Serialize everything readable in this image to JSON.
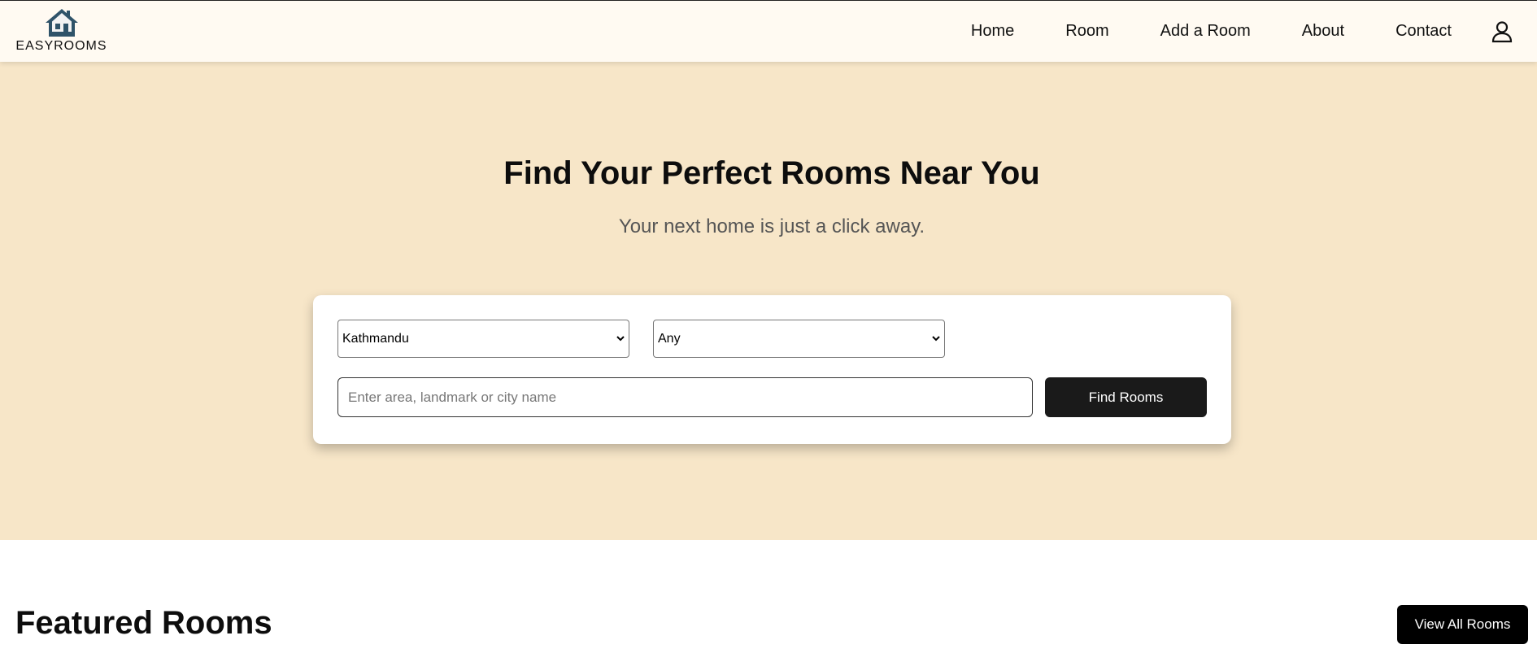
{
  "brand": {
    "name": "EASYROOMS",
    "logo_icon": "house-icon",
    "accent": "#2f5369"
  },
  "nav": {
    "items": [
      {
        "label": "Home"
      },
      {
        "label": "Room"
      },
      {
        "label": "Add a Room"
      },
      {
        "label": "About"
      },
      {
        "label": "Contact"
      }
    ],
    "account_icon": "user-icon"
  },
  "hero": {
    "title": "Find Your Perfect Rooms Near You",
    "subtitle": "Your next home is just a click away.",
    "background": "#f7e6c8"
  },
  "search": {
    "city_select": {
      "value": "Kathmandu"
    },
    "type_select": {
      "value": "Any"
    },
    "input": {
      "value": "",
      "placeholder": "Enter area, landmark or city name"
    },
    "submit_label": "Find Rooms"
  },
  "featured": {
    "title": "Featured Rooms",
    "view_all_label": "View All Rooms"
  }
}
